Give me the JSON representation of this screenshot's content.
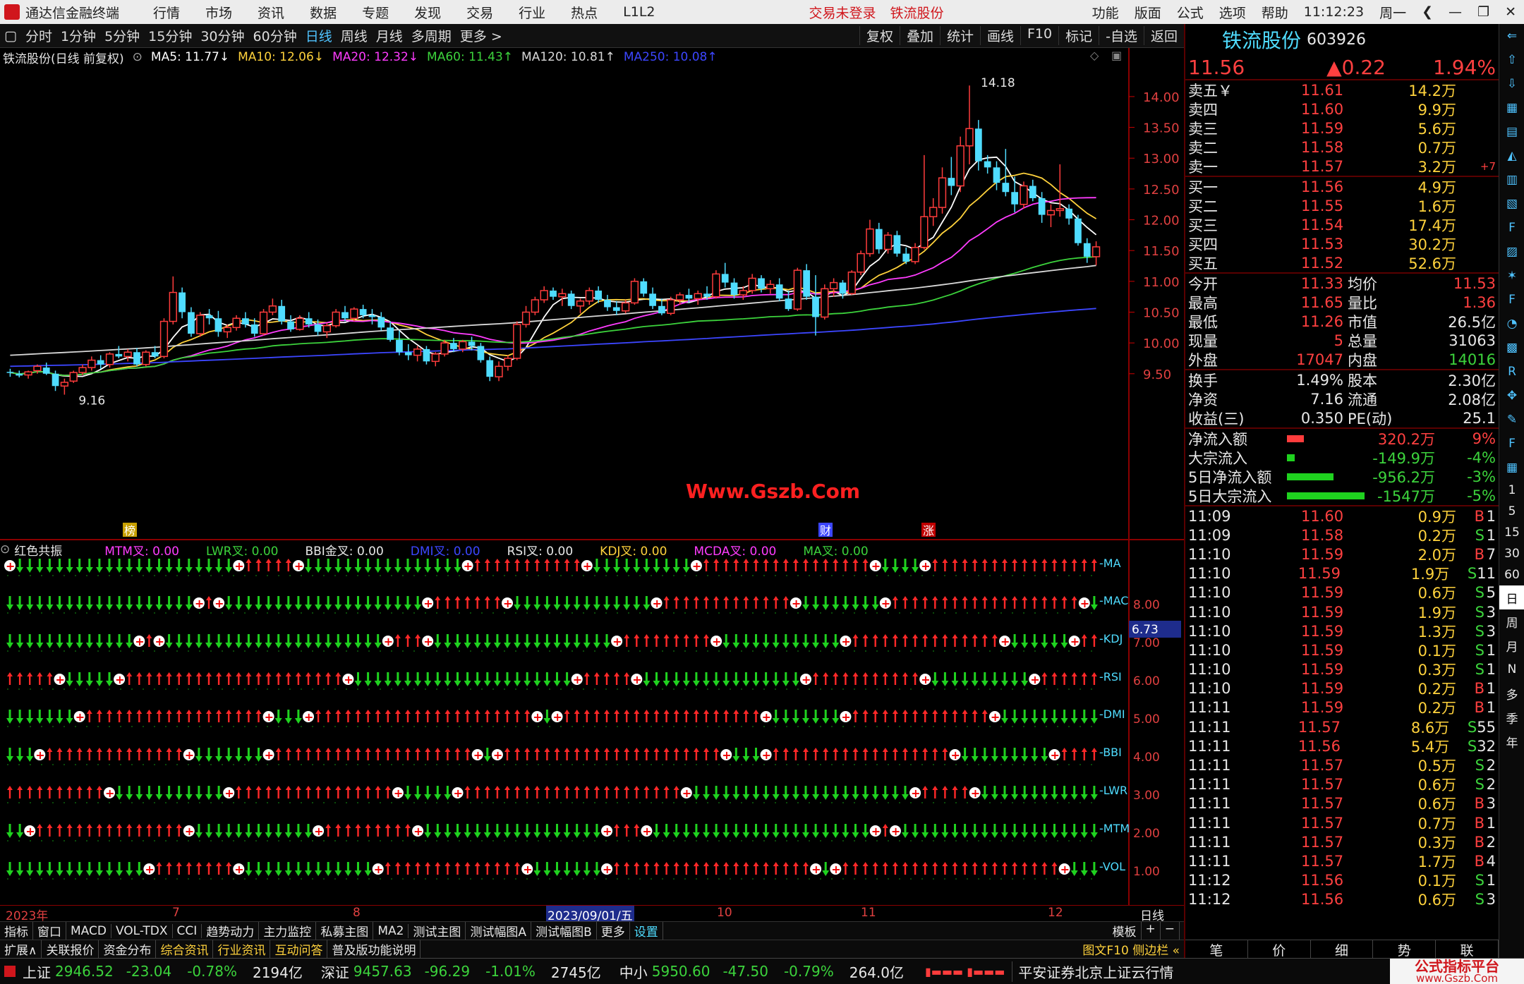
{
  "titlebar": {
    "app": "通达信金融终端",
    "menus": [
      "行情",
      "市场",
      "资讯",
      "数据",
      "专题",
      "发现",
      "交易",
      "行业",
      "热点",
      "L1L2"
    ],
    "status": "交易未登录",
    "stock": "铁流股份",
    "right_menus": [
      "功能",
      "版面",
      "公式",
      "选项",
      "帮助"
    ],
    "time": "11:12:23",
    "weekday": "周一"
  },
  "toolbar": {
    "periods": [
      "分时",
      "1分钟",
      "5分钟",
      "15分钟",
      "30分钟",
      "60分钟",
      "日线",
      "周线",
      "月线",
      "多周期",
      "更多 >"
    ],
    "active": "日线",
    "tools": [
      "复权",
      "叠加",
      "统计",
      "画线",
      "F10",
      "标记",
      "-自选",
      "返回"
    ]
  },
  "ma_legend": {
    "title": "铁流股份(日线 前复权)",
    "items": [
      {
        "t": "MA5: 11.77↓",
        "c": "#ffffff"
      },
      {
        "t": "MA10: 12.06↓",
        "c": "#ffd23c"
      },
      {
        "t": "MA20: 12.32↓",
        "c": "#ff3cff"
      },
      {
        "t": "MA60: 11.43↑",
        "c": "#3cd33c"
      },
      {
        "t": "MA120: 10.81↑",
        "c": "#d8d8d8"
      },
      {
        "t": "MA250: 10.08↑",
        "c": "#3c46ff"
      }
    ]
  },
  "chart_data": {
    "type": "candlestick",
    "price_axis": [
      "14.00",
      "13.50",
      "13.00",
      "12.50",
      "12.00",
      "11.50",
      "11.00",
      "10.50",
      "10.00",
      "9.50"
    ],
    "ylim": [
      9.2,
      14.4
    ],
    "high_label": "14.18",
    "low_label": "9.16",
    "watermark": "Www.Gszb.Com",
    "markers": [
      "榜",
      "财",
      "涨"
    ],
    "ohlc": [
      [
        9.53,
        9.58,
        9.45,
        9.52
      ],
      [
        9.5,
        9.55,
        9.44,
        9.47
      ],
      [
        9.48,
        9.55,
        9.42,
        9.53
      ],
      [
        9.55,
        9.65,
        9.5,
        9.62
      ],
      [
        9.6,
        9.68,
        9.48,
        9.5
      ],
      [
        9.5,
        9.55,
        9.22,
        9.3
      ],
      [
        9.3,
        9.42,
        9.16,
        9.36
      ],
      [
        9.38,
        9.55,
        9.35,
        9.52
      ],
      [
        9.52,
        9.65,
        9.48,
        9.6
      ],
      [
        9.6,
        9.78,
        9.55,
        9.72
      ],
      [
        9.72,
        9.8,
        9.58,
        9.65
      ],
      [
        9.65,
        9.85,
        9.6,
        9.82
      ],
      [
        9.82,
        9.95,
        9.75,
        9.78
      ],
      [
        9.78,
        9.9,
        9.7,
        9.85
      ],
      [
        9.85,
        9.92,
        9.62,
        9.65
      ],
      [
        9.65,
        9.88,
        9.62,
        9.85
      ],
      [
        9.85,
        9.95,
        9.75,
        9.78
      ],
      [
        9.78,
        10.4,
        9.75,
        10.35
      ],
      [
        10.35,
        11.08,
        10.3,
        10.82
      ],
      [
        10.82,
        10.9,
        10.4,
        10.5
      ],
      [
        10.5,
        10.58,
        10.1,
        10.15
      ],
      [
        10.15,
        10.5,
        10.1,
        10.45
      ],
      [
        10.45,
        10.55,
        10.3,
        10.4
      ],
      [
        10.4,
        10.52,
        10.1,
        10.18
      ],
      [
        10.18,
        10.3,
        10.08,
        10.25
      ],
      [
        10.25,
        10.45,
        10.2,
        10.4
      ],
      [
        10.4,
        10.5,
        10.25,
        10.3
      ],
      [
        10.3,
        10.4,
        10.1,
        10.15
      ],
      [
        10.15,
        10.55,
        10.12,
        10.5
      ],
      [
        10.5,
        10.72,
        10.45,
        10.6
      ],
      [
        10.6,
        10.7,
        10.3,
        10.35
      ],
      [
        10.35,
        10.45,
        10.18,
        10.22
      ],
      [
        10.22,
        10.45,
        10.2,
        10.4
      ],
      [
        10.4,
        10.5,
        10.25,
        10.3
      ],
      [
        10.3,
        10.38,
        10.12,
        10.18
      ],
      [
        10.18,
        10.32,
        10.08,
        10.28
      ],
      [
        10.28,
        10.55,
        10.25,
        10.5
      ],
      [
        10.5,
        10.6,
        10.35,
        10.4
      ],
      [
        10.4,
        10.58,
        10.35,
        10.55
      ],
      [
        10.55,
        10.62,
        10.4,
        10.45
      ],
      [
        10.45,
        10.55,
        10.3,
        10.42
      ],
      [
        10.42,
        10.5,
        10.2,
        10.25
      ],
      [
        10.25,
        10.35,
        10.02,
        10.05
      ],
      [
        10.05,
        10.2,
        9.8,
        9.85
      ],
      [
        9.85,
        9.98,
        9.72,
        9.8
      ],
      [
        9.8,
        9.95,
        9.7,
        9.9
      ],
      [
        9.9,
        9.95,
        9.65,
        9.7
      ],
      [
        9.7,
        9.85,
        9.62,
        9.82
      ],
      [
        9.82,
        10.05,
        9.78,
        10.0
      ],
      [
        10.0,
        10.08,
        9.85,
        9.9
      ],
      [
        9.9,
        10.05,
        9.85,
        10.02
      ],
      [
        10.02,
        10.1,
        9.88,
        9.95
      ],
      [
        9.95,
        10.0,
        9.68,
        9.72
      ],
      [
        9.72,
        9.78,
        9.38,
        9.45
      ],
      [
        9.45,
        9.7,
        9.38,
        9.62
      ],
      [
        9.62,
        9.8,
        9.55,
        9.75
      ],
      [
        9.75,
        10.35,
        9.72,
        10.3
      ],
      [
        10.3,
        10.6,
        10.25,
        10.5
      ],
      [
        10.5,
        10.75,
        10.45,
        10.7
      ],
      [
        10.7,
        10.92,
        10.65,
        10.85
      ],
      [
        10.85,
        10.9,
        10.7,
        10.75
      ],
      [
        10.75,
        10.88,
        10.6,
        10.8
      ],
      [
        10.8,
        10.85,
        10.55,
        10.6
      ],
      [
        10.6,
        10.72,
        10.48,
        10.68
      ],
      [
        10.68,
        10.9,
        10.62,
        10.85
      ],
      [
        10.85,
        10.92,
        10.65,
        10.7
      ],
      [
        10.7,
        10.78,
        10.52,
        10.58
      ],
      [
        10.58,
        10.68,
        10.45,
        10.52
      ],
      [
        10.52,
        10.7,
        10.48,
        10.65
      ],
      [
        10.65,
        11.05,
        10.62,
        11.0
      ],
      [
        11.0,
        11.05,
        10.75,
        10.8
      ],
      [
        10.8,
        10.9,
        10.55,
        10.6
      ],
      [
        10.6,
        10.72,
        10.45,
        10.48
      ],
      [
        10.48,
        10.75,
        10.45,
        10.7
      ],
      [
        10.7,
        10.82,
        10.62,
        10.78
      ],
      [
        10.78,
        10.88,
        10.65,
        10.72
      ],
      [
        10.72,
        10.85,
        10.62,
        10.8
      ],
      [
        10.8,
        10.92,
        10.7,
        10.75
      ],
      [
        10.75,
        11.18,
        10.72,
        11.12
      ],
      [
        11.12,
        11.3,
        10.9,
        10.98
      ],
      [
        10.98,
        11.05,
        10.72,
        10.78
      ],
      [
        10.78,
        10.92,
        10.7,
        10.85
      ],
      [
        10.85,
        11.12,
        10.8,
        11.05
      ],
      [
        11.05,
        11.1,
        10.82,
        10.88
      ],
      [
        10.88,
        11.02,
        10.8,
        10.95
      ],
      [
        10.95,
        11.05,
        10.68,
        10.72
      ],
      [
        10.72,
        10.85,
        10.52,
        10.55
      ],
      [
        10.55,
        11.22,
        10.52,
        11.18
      ],
      [
        11.18,
        11.28,
        10.7,
        10.75
      ],
      [
        10.75,
        11.1,
        10.12,
        10.42
      ],
      [
        10.42,
        10.95,
        10.38,
        10.88
      ],
      [
        10.88,
        11.05,
        10.75,
        10.98
      ],
      [
        10.98,
        11.02,
        10.72,
        10.8
      ],
      [
        10.8,
        11.18,
        10.78,
        11.15
      ],
      [
        11.15,
        11.5,
        11.1,
        11.45
      ],
      [
        11.45,
        12.0,
        11.4,
        11.85
      ],
      [
        11.85,
        11.95,
        11.45,
        11.52
      ],
      [
        11.52,
        11.8,
        11.45,
        11.75
      ],
      [
        11.75,
        11.82,
        11.4,
        11.45
      ],
      [
        11.45,
        11.55,
        11.28,
        11.32
      ],
      [
        11.32,
        11.62,
        11.28,
        11.55
      ],
      [
        11.55,
        13.05,
        11.52,
        12.05
      ],
      [
        12.05,
        12.35,
        11.9,
        12.2
      ],
      [
        12.2,
        12.85,
        12.1,
        12.68
      ],
      [
        12.68,
        13.02,
        12.4,
        12.55
      ],
      [
        12.55,
        13.35,
        12.45,
        13.2
      ],
      [
        13.2,
        14.18,
        12.9,
        13.48
      ],
      [
        13.48,
        13.62,
        12.8,
        12.95
      ],
      [
        12.95,
        13.05,
        12.75,
        12.85
      ],
      [
        12.85,
        12.95,
        12.48,
        12.6
      ],
      [
        12.6,
        13.15,
        12.38,
        12.45
      ],
      [
        12.45,
        12.7,
        12.12,
        12.25
      ],
      [
        12.25,
        12.62,
        12.18,
        12.55
      ],
      [
        12.55,
        12.65,
        12.3,
        12.35
      ],
      [
        12.35,
        12.45,
        11.95,
        12.08
      ],
      [
        12.08,
        12.25,
        11.88,
        12.15
      ],
      [
        12.15,
        12.9,
        12.05,
        12.18
      ],
      [
        12.18,
        12.25,
        11.92,
        12.02
      ],
      [
        12.02,
        12.08,
        11.58,
        11.62
      ],
      [
        11.62,
        11.7,
        11.3,
        11.4
      ],
      [
        11.4,
        11.65,
        11.26,
        11.56
      ]
    ]
  },
  "indicator": {
    "title": "红色共振",
    "items": [
      {
        "t": "MTM叉: 0.00",
        "c": "#ff3cff"
      },
      {
        "t": "LWR叉: 0.00",
        "c": "#3cd33c"
      },
      {
        "t": "BBI金叉: 0.00",
        "c": "#e8e8e8"
      },
      {
        "t": "DMI叉: 0.00",
        "c": "#3c46ff"
      },
      {
        "t": "RSI叉: 0.00",
        "c": "#e8e8e8"
      },
      {
        "t": "KDJ叉: 0.00",
        "c": "#ffd23c"
      },
      {
        "t": "MCDA叉: 0.00",
        "c": "#ff3cff"
      },
      {
        "t": "MA叉: 0.00",
        "c": "#3cd33c"
      }
    ],
    "row_labels": [
      "MA",
      "MAC",
      "KDJ",
      "RSI",
      "DMI",
      "BBI",
      "LWR",
      "MTM",
      "VOL"
    ],
    "axis": [
      "8.00",
      "7.00",
      "6.00",
      "5.00",
      "4.00",
      "3.00",
      "2.00",
      "1.00"
    ],
    "cursor_value": "6.73"
  },
  "date_axis": {
    "labels": [
      "2023年",
      "7",
      "8",
      "10",
      "11",
      "12"
    ],
    "highlight": "2023/09/01/五",
    "period_label": "日线"
  },
  "tabs1": [
    "指标",
    "窗口",
    "MACD",
    "VOL-TDX",
    "CCI",
    "趋势动力",
    "主力监控",
    "私募主图",
    "MA2",
    "测试主图",
    "测试幅图A",
    "测试幅图B",
    "更多",
    "设置"
  ],
  "tabs1_right": [
    "模板",
    "+",
    "−"
  ],
  "tabs2": [
    "扩展∧",
    "关联报价",
    "资金分布",
    "综合资讯",
    "行业资讯",
    "互动问答",
    "普及版功能说明"
  ],
  "tabs2_right": "图文F10 侧边栏 «",
  "panel": {
    "name": "铁流股份",
    "code": "603926",
    "price": "11.56",
    "change": "▲0.22",
    "pct": "1.94%",
    "asks": [
      [
        "卖五￥",
        "11.61",
        "14.2万"
      ],
      [
        "卖四",
        "11.60",
        "9.9万"
      ],
      [
        "卖三",
        "11.59",
        "5.6万"
      ],
      [
        "卖二",
        "11.58",
        "0.7万"
      ],
      [
        "卖一",
        "11.57",
        "3.2万"
      ]
    ],
    "ask1_delta": "+7",
    "bids": [
      [
        "买一",
        "11.56",
        "4.9万"
      ],
      [
        "买二",
        "11.55",
        "1.6万"
      ],
      [
        "买三",
        "11.54",
        "17.4万"
      ],
      [
        "买四",
        "11.53",
        "30.2万"
      ],
      [
        "买五",
        "11.52",
        "52.6万"
      ]
    ],
    "stats": [
      [
        "今开",
        "11.33",
        "均价",
        "11.53"
      ],
      [
        "最高",
        "11.65",
        "量比",
        "1.36"
      ],
      [
        "最低",
        "11.26",
        "市值",
        "26.5亿"
      ],
      [
        "现量",
        "5",
        "总量",
        "31063"
      ],
      [
        "外盘",
        "17047",
        "内盘",
        "14016"
      ]
    ],
    "stats2": [
      [
        "换手",
        "1.49%",
        "股本",
        "2.30亿"
      ],
      [
        "净资",
        "7.16",
        "流通",
        "2.08亿"
      ],
      [
        "收益(三)",
        "0.350",
        "PE(动)",
        "25.1"
      ]
    ],
    "flows": [
      {
        "label": "净流入额",
        "value": "320.2万",
        "pct": "9%",
        "dir": "up",
        "bar": 0.22
      },
      {
        "label": "大宗流入",
        "value": "-149.9万",
        "pct": "-4%",
        "dir": "dn",
        "bar": 0.1
      },
      {
        "label": "5日净流入额",
        "value": "-956.2万",
        "pct": "-3%",
        "dir": "dn",
        "bar": 0.6
      },
      {
        "label": "5日大宗流入",
        "value": "-1547万",
        "pct": "-5%",
        "dir": "dn",
        "bar": 1.0
      }
    ],
    "ticks": [
      [
        "11:09",
        "11.60",
        "0.9万",
        "B",
        "1"
      ],
      [
        "11:09",
        "11.58",
        "0.2万",
        "S",
        "1"
      ],
      [
        "11:10",
        "11.59",
        "2.0万",
        "B",
        "7"
      ],
      [
        "11:10",
        "11.59",
        "1.9万",
        "S",
        "11"
      ],
      [
        "11:10",
        "11.59",
        "0.6万",
        "S",
        "5"
      ],
      [
        "11:10",
        "11.59",
        "1.9万",
        "S",
        "3"
      ],
      [
        "11:10",
        "11.59",
        "1.3万",
        "S",
        "3"
      ],
      [
        "11:10",
        "11.59",
        "0.1万",
        "S",
        "1"
      ],
      [
        "11:10",
        "11.59",
        "0.3万",
        "S",
        "1"
      ],
      [
        "11:10",
        "11.59",
        "0.2万",
        "B",
        "1"
      ],
      [
        "11:11",
        "11.59",
        "0.2万",
        "B",
        "1"
      ],
      [
        "11:11",
        "11.57",
        "8.6万",
        "S",
        "55"
      ],
      [
        "11:11",
        "11.56",
        "5.4万",
        "S",
        "32"
      ],
      [
        "11:11",
        "11.57",
        "0.5万",
        "S",
        "2"
      ],
      [
        "11:11",
        "11.57",
        "0.6万",
        "S",
        "2"
      ],
      [
        "11:11",
        "11.57",
        "0.6万",
        "B",
        "3"
      ],
      [
        "11:11",
        "11.57",
        "0.7万",
        "B",
        "1"
      ],
      [
        "11:11",
        "11.57",
        "0.3万",
        "B",
        "2"
      ],
      [
        "11:11",
        "11.57",
        "1.7万",
        "B",
        "4"
      ],
      [
        "11:12",
        "11.56",
        "0.1万",
        "S",
        "1"
      ],
      [
        "11:12",
        "11.56",
        "0.6万",
        "S",
        "3"
      ]
    ],
    "bottom_tabs": [
      "笔",
      "价",
      "细",
      "势",
      "联"
    ]
  },
  "sidebar": [
    "日",
    "周",
    "月",
    "N",
    "多",
    "季",
    "年"
  ],
  "sidebar_numbers": [
    "1",
    "5",
    "15",
    "30",
    "60"
  ],
  "statusbar": {
    "items": [
      {
        "name": "上证",
        "v": "2946.52",
        "c": "-23.04",
        "p": "-0.78%",
        "amt": "2194亿"
      },
      {
        "name": "深证",
        "v": "9457.63",
        "c": "-96.29",
        "p": "-1.01%",
        "amt": "2745亿"
      },
      {
        "name": "中小",
        "v": "5950.60",
        "c": "-47.50",
        "p": "-0.79%",
        "amt": "264.0亿"
      }
    ],
    "server": "平安证券北京上证云行情",
    "brand": "公式指标平台",
    "brand_url": "www.Gszb.Com"
  }
}
